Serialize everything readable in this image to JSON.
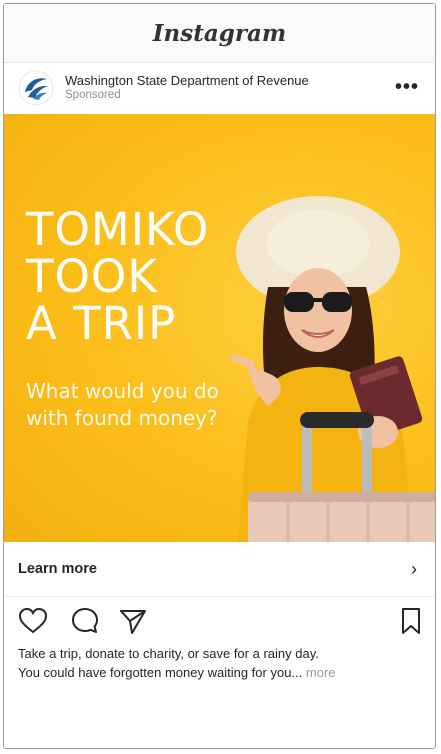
{
  "app": {
    "brand": "Instagram"
  },
  "post": {
    "account_name": "Washington State Department of Revenue",
    "account_sub": "Sponsored",
    "more_icon": "more-dots-icon"
  },
  "ad": {
    "headline_lines": [
      "TOMIKO",
      "TOOK",
      "A TRIP"
    ],
    "subhead_lines": [
      "What would you do",
      "with found money?"
    ],
    "background_color": "#fbbd18"
  },
  "cta": {
    "label": "Learn more",
    "chevron": "›"
  },
  "actions": {
    "icons": [
      "heart-icon",
      "comment-icon",
      "share-icon",
      "bookmark-icon"
    ]
  },
  "caption": {
    "line1": "Take a trip, donate to charity, or save for a rainy day.",
    "line2": "You could have forgotten money waiting for you...",
    "more": "more"
  }
}
